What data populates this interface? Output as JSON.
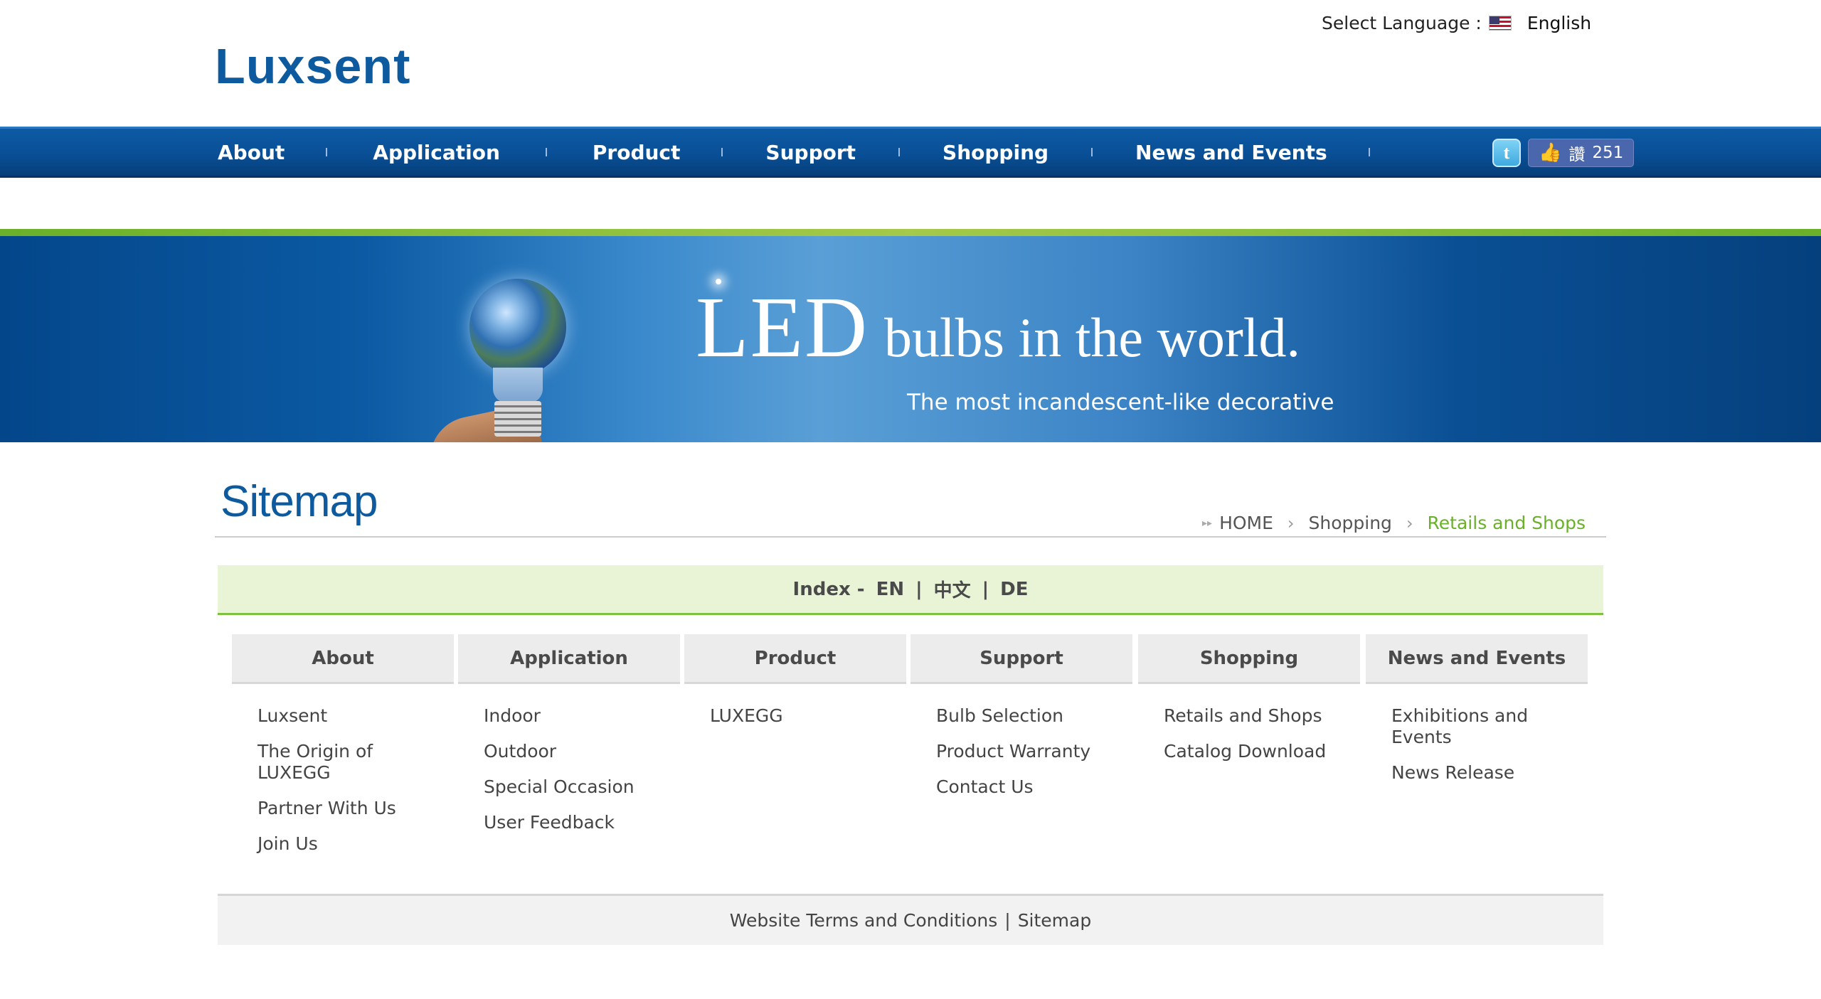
{
  "header": {
    "select_language_label": "Select Language :",
    "language": "English",
    "logo_text": "Luxsent"
  },
  "nav": {
    "items": [
      "About",
      "Application",
      "Product",
      "Support",
      "Shopping",
      "News and Events"
    ],
    "twitter_icon": "twitter-icon",
    "like_label": "讚",
    "like_count": "251"
  },
  "banner": {
    "led": "LED",
    "headline_rest": "bulbs in the world.",
    "subtitle": "The most incandescent-like decorative"
  },
  "page": {
    "title": "Sitemap",
    "breadcrumb": [
      "HOME",
      "Shopping",
      "Retails and Shops"
    ]
  },
  "index_bar": {
    "index_label": "Index -",
    "lang_en": "EN",
    "lang_zh": "中文",
    "lang_de": "DE",
    "pipe": "|"
  },
  "columns": [
    {
      "heading": "About",
      "links": [
        "Luxsent",
        "The Origin of LUXEGG",
        "Partner With Us",
        "Join Us"
      ]
    },
    {
      "heading": "Application",
      "links": [
        "Indoor",
        "Outdoor",
        "Special Occasion",
        "User Feedback"
      ]
    },
    {
      "heading": "Product",
      "links": [
        "LUXEGG"
      ]
    },
    {
      "heading": "Support",
      "links": [
        "Bulb Selection",
        "Product Warranty",
        "Contact Us"
      ]
    },
    {
      "heading": "Shopping",
      "links": [
        "Retails and Shops",
        "Catalog Download"
      ]
    },
    {
      "heading": "News and Events",
      "links": [
        "Exhibitions and Events",
        "News Release"
      ]
    }
  ],
  "footer": {
    "terms": "Website Terms and Conditions",
    "pipe": "|",
    "sitemap": "Sitemap"
  },
  "colors": {
    "brand_blue": "#0d5a9e",
    "accent_green": "#6ab02a",
    "nav_bg": "#094f96"
  }
}
